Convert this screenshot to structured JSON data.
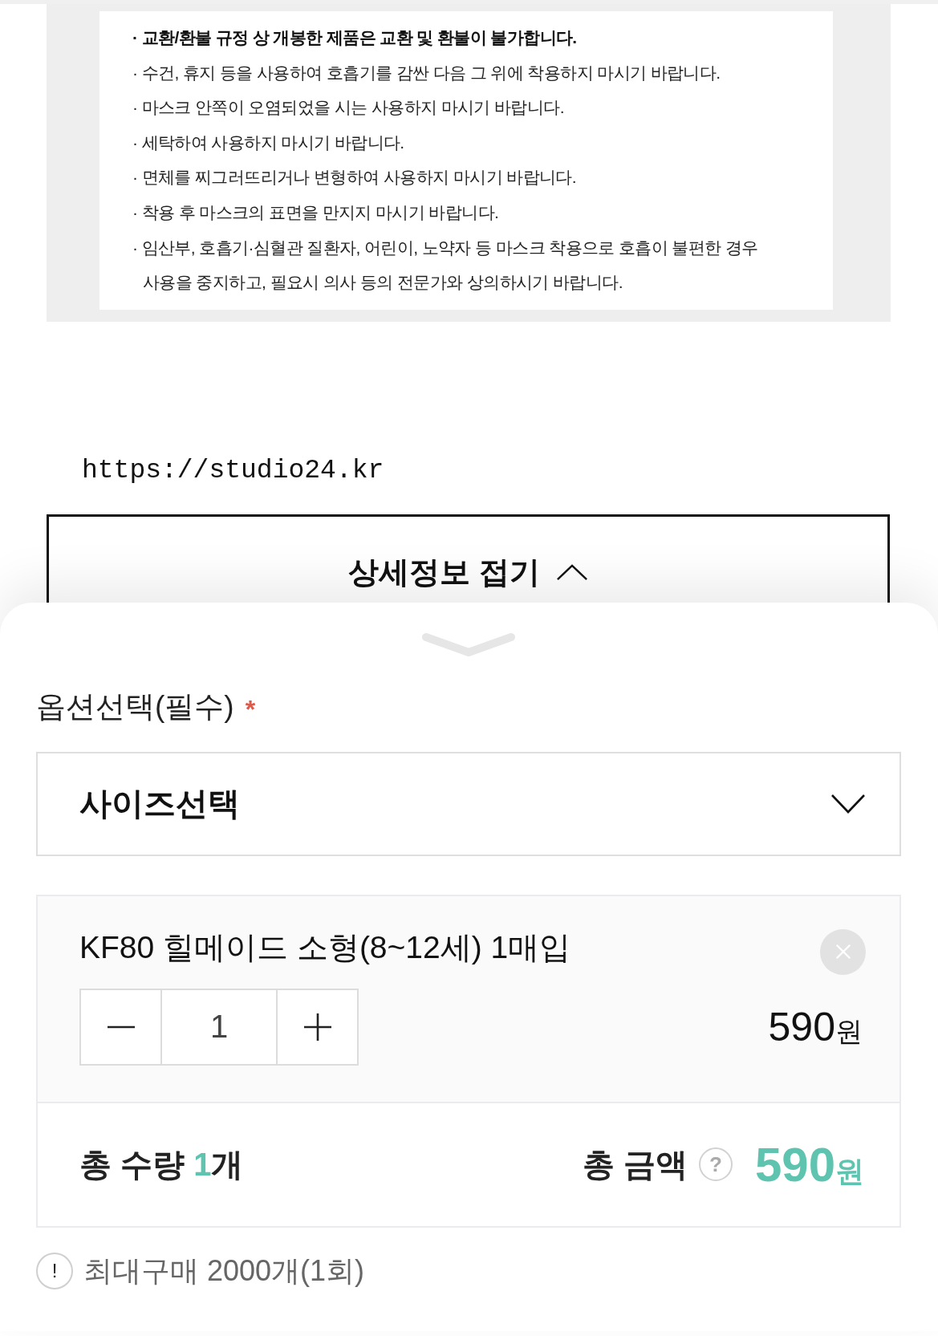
{
  "notice_box": {
    "items": [
      {
        "lines": [
          "· 교환/환불 규정 상 개봉한 제품은 교환 및 환불이 불가합니다."
        ],
        "bold": true
      },
      {
        "lines": [
          "· 수건, 휴지 등을 사용하여 호흡기를 감싼 다음 그 위에 착용하지 마시기 바랍니다."
        ],
        "bold": false
      },
      {
        "lines": [
          "· 마스크 안쪽이 오염되었을 시는 사용하지 마시기 바랍니다."
        ],
        "bold": false
      },
      {
        "lines": [
          "· 세탁하여 사용하지 마시기 바랍니다."
        ],
        "bold": false
      },
      {
        "lines": [
          "· 면체를 찌그러뜨리거나 변형하여 사용하지 마시기 바랍니다."
        ],
        "bold": false
      },
      {
        "lines": [
          "· 착용 후 마스크의 표면을 만지지 마시기 바랍니다."
        ],
        "bold": false
      },
      {
        "lines": [
          "· 임산부, 호흡기·심혈관 질환자, 어린이, 노약자 등 마스크 착용으로 호흡이 불편한 경우",
          "사용을 중지하고, 필요시 의사 등의 전문가와 상의하시기 바랍니다."
        ],
        "bold": false
      }
    ]
  },
  "link": {
    "url": "https://studio24.kr"
  },
  "collapse_button": {
    "label": "상세정보 접기"
  },
  "option_sheet": {
    "label": "옵션선택(필수)",
    "required_mark": "*",
    "select": {
      "label": "사이즈선택"
    },
    "selected_item": {
      "name": "KF80 힐메이드 소형(8~12세) 1매입",
      "quantity": "1",
      "price": "590",
      "currency": "원"
    },
    "totals": {
      "quantity_label": "총 수량",
      "quantity": "1",
      "quantity_unit": "개",
      "amount_label": "총 금액",
      "help_icon": "?",
      "amount": "590",
      "currency": "원"
    },
    "purchase_limit": {
      "icon": "!",
      "text": "최대구매 2000개(1회)"
    }
  }
}
